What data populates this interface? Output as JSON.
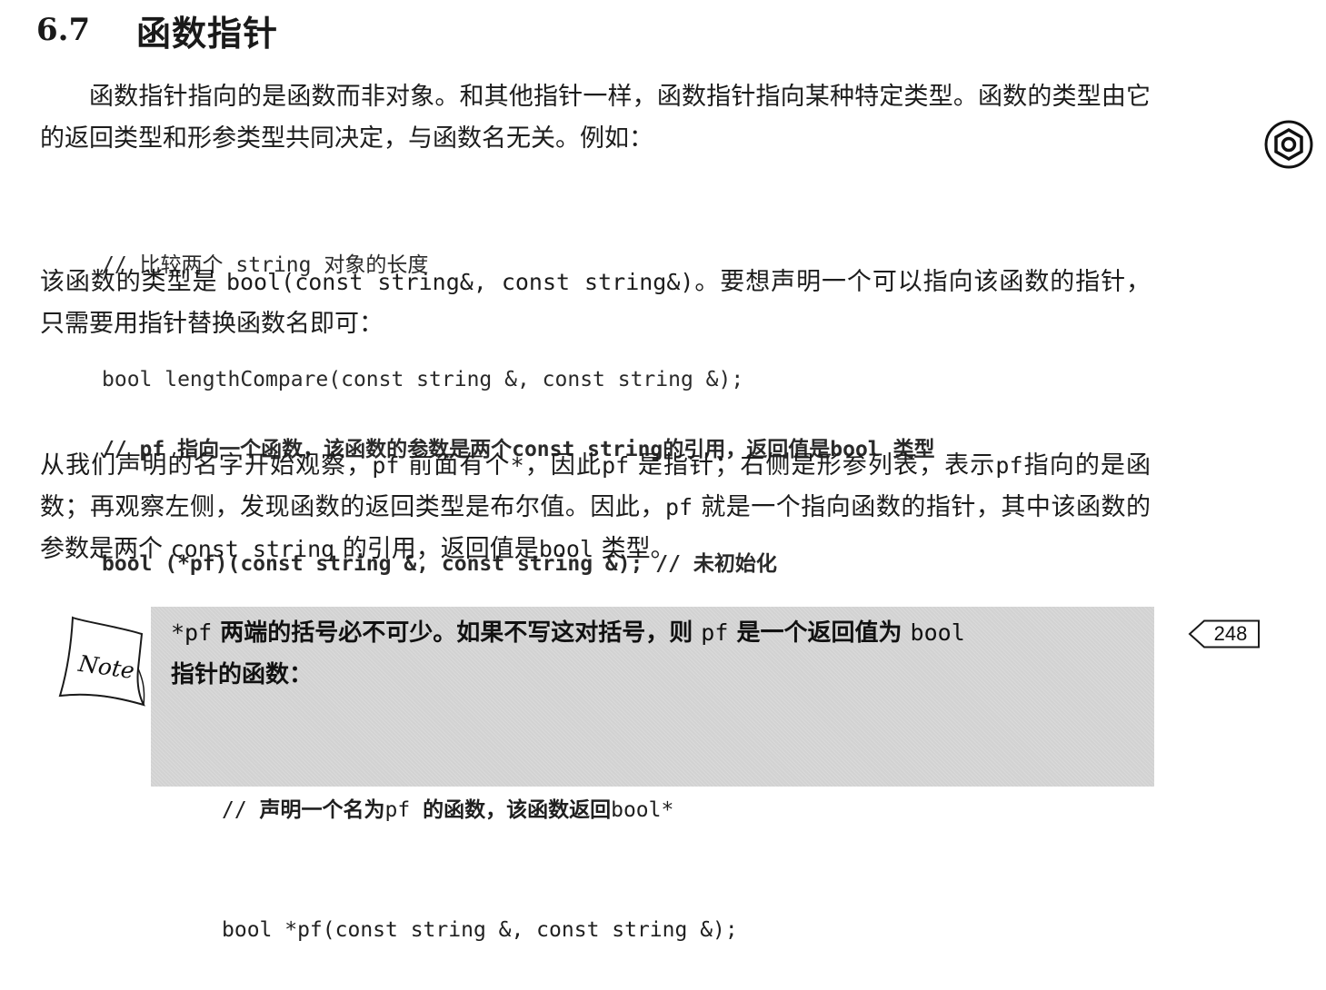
{
  "section": {
    "number": "6.7",
    "title": "函数指针"
  },
  "para1": {
    "text": "函数指针指向的是函数而非对象。和其他指针一样，函数指针指向某种特定类型。函数的类型由它的返回类型和形参类型共同决定，与函数名无关。例如："
  },
  "code1": {
    "comment_prefix": "// ",
    "comment_a": "比较两个",
    "comment_b": "string",
    "comment_c": "对象的长度",
    "line2": "bool lengthCompare(const string &, const string &);"
  },
  "para2": {
    "text_a": "该函数的类型是",
    "code": "bool(const string&, const string&)",
    "text_b": "。要想声明一个可以指向该函数的指针，只需要用指针替换函数名即可："
  },
  "code2": {
    "comment_prefix": "// pf ",
    "comment_a": "指向一个函数，该函数的参数是两个",
    "comment_b": "const string",
    "comment_c": "的引用，返回值是",
    "comment_d": "bool",
    "comment_e": "类型",
    "line2_code": "bool (*pf)(const string &, const string &); // ",
    "line2_comment": "未初始化"
  },
  "para3": {
    "t1": "从我们声明的名字开始观察，",
    "c1": "pf",
    "t2": "前面有个",
    "c2": "*",
    "t3": "，因此",
    "c3": "pf",
    "t4": "是指针；右侧是形参列表，表示",
    "c4": "pf",
    "t5": "指向的是函数；再观察左侧，发现函数的返回类型是布尔值。因此，",
    "c5": "pf",
    "t6": "就是一个指向函数的指针，其中该函数的参数是两个",
    "c6": "const string",
    "t7": "的引用，返回值是",
    "c7": "bool",
    "t8": "类型。"
  },
  "note": {
    "icon_label": "Note",
    "c1": "*pf",
    "t1": "两端的括号必不可少。如果不写这对括号，则",
    "c2": "pf",
    "t2": "是一个返回值为",
    "c3": "bool",
    "t3": "指针的函数：",
    "code_comment_prefix": "// ",
    "code_comment_a": "声明一个名为",
    "code_comment_b": "pf",
    "code_comment_c": "的函数，该函数返回",
    "code_comment_d": "bool*",
    "code_line2": "bool *pf(const string &, const string &);"
  },
  "page_number": "248",
  "icons": {
    "side": "hexagon-nut-icon",
    "note": "note-paper-icon",
    "page": "page-pointer-icon"
  }
}
